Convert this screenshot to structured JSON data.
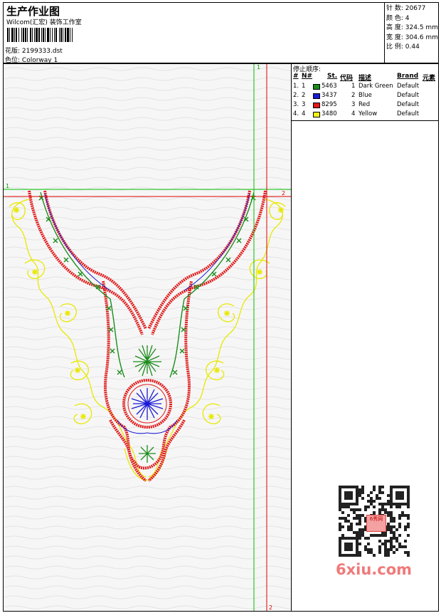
{
  "header": {
    "title": "生产作业图",
    "company": "Wilcom(汇宏) 装饰工作室",
    "design_label": "花版:",
    "design_value": "2199333.dst",
    "colorway_label": "色位:",
    "colorway_value": "Colorway 1"
  },
  "stats": {
    "stitches_label": "针 数:",
    "stitches_value": "20677",
    "colors_label": "颜 色:",
    "colors_value": "4",
    "height_label": "高 度:",
    "height_value": "324.5 mm",
    "width_label": "宽 度:",
    "width_value": "304.6 mm",
    "scale_label": "比 例:",
    "scale_value": "0.44"
  },
  "legend": {
    "title": "停止顺序:",
    "headers": {
      "num": "#",
      "no": "N#",
      "st": "St.",
      "code": "代码",
      "desc": "描述",
      "brand": "Brand",
      "element": "元素"
    },
    "rows": [
      {
        "num": "1.",
        "no": "1",
        "color": "#1a8c1a",
        "st": "5463",
        "code": "1",
        "desc": "Dark Green",
        "brand": "Default"
      },
      {
        "num": "2.",
        "no": "2",
        "color": "#1a1ad6",
        "st": "3437",
        "code": "2",
        "desc": "Blue",
        "brand": "Default"
      },
      {
        "num": "3.",
        "no": "3",
        "color": "#e01a1a",
        "st": "8295",
        "code": "3",
        "desc": "Red",
        "brand": "Default"
      },
      {
        "num": "4.",
        "no": "4",
        "color": "#f2f21a",
        "st": "3480",
        "code": "4",
        "desc": "Yellow",
        "brand": "Default"
      }
    ]
  },
  "guides": {
    "v_green_label": "1",
    "h_green_label": "1",
    "h_red_label": "2",
    "v_red_label": "2",
    "green_color": "#00c000",
    "red_color": "#e00000"
  },
  "watermark": {
    "text": "6xiu.com",
    "seal": "6秀网"
  }
}
